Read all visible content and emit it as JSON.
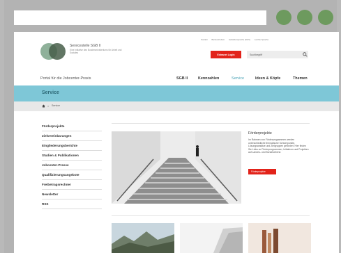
{
  "logo": {
    "title": "Servicestelle SGB II",
    "subtitle": "Eine Initiative des Bundesministeriums für Arbeit und Soziales"
  },
  "top_links": [
    "Kontakt",
    "Barrierefreiheit",
    "Gebärdensprache (DGS)",
    "Leichte Sprache"
  ],
  "login_label": "Extranet Login",
  "search": {
    "value": "Suchbegriff"
  },
  "portal_title": "Portal für die Jobcenter-Praxis",
  "nav": [
    "SGB II",
    "Kennzahlen",
    "Service",
    "Ideen & Köpfe",
    "Themen"
  ],
  "band_title": "Service",
  "breadcrumb": {
    "separator": ">",
    "current": "Service"
  },
  "sidebar": [
    "Förderprojekte",
    "Zielvereinbarungen",
    "Eingliederungsberichte",
    "Studien & Publikationen",
    "Jobcenter-Presse",
    "Qualifizierungsangebote",
    "Freibetragsrechner",
    "Newsletter",
    "RSS"
  ],
  "feature": {
    "title": "Förderprojekte",
    "text": "Im Rahmen von Förderprogrammen werden unterschiedliche thematische Schwerpunkte, Lösungsansätze und Zielgruppen gefördert. Hier finden Sie Links zu Förderprogrammen, Initiativen und Projekten auf Landes- und Bundesebene.",
    "more_label": "Förderprojekte"
  },
  "colors": {
    "accent": "#7ec7d7",
    "red": "#e2231a",
    "green": "#6d9a5e"
  }
}
